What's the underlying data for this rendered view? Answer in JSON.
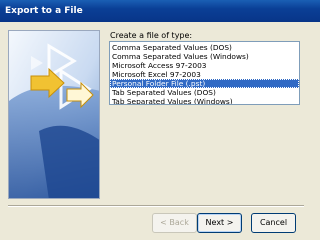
{
  "window": {
    "title": "Export to a File"
  },
  "list": {
    "label": "Create a file of type:",
    "items": [
      "Comma Separated Values (DOS)",
      "Comma Separated Values (Windows)",
      "Microsoft Access 97-2003",
      "Microsoft Excel 97-2003",
      "Personal Folder File (.pst)",
      "Tab Separated Values (DOS)",
      "Tab Separated Values (Windows)"
    ],
    "selected": "Personal Folder File (.pst)"
  },
  "buttons": {
    "back": "< Back",
    "next": "Next >",
    "cancel": "Cancel"
  },
  "colors": {
    "title_bar": "#0a3f96",
    "selection": "#316ac5",
    "dialog_bg": "#ece9d8"
  }
}
